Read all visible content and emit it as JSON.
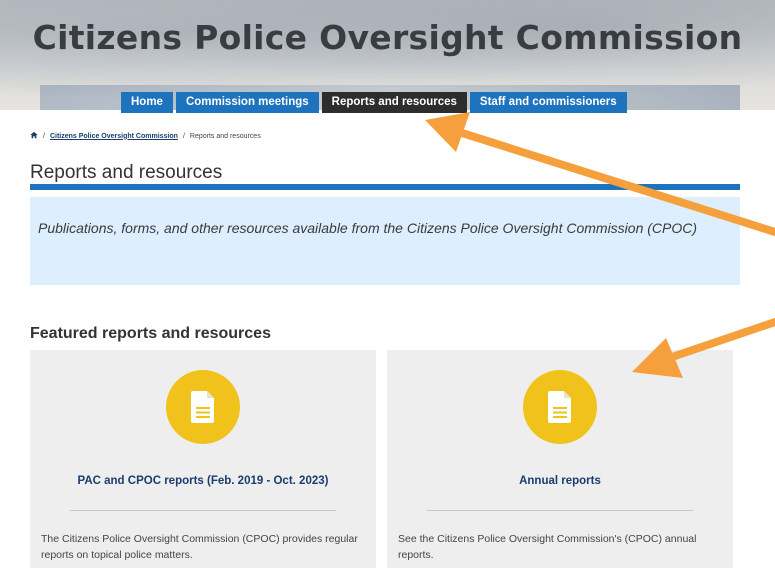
{
  "header": {
    "site_title": "Citizens Police Oversight Commission",
    "nav": [
      {
        "label": "Home"
      },
      {
        "label": "Commission meetings"
      },
      {
        "label": "Reports and resources",
        "active": true
      },
      {
        "label": "Staff and commissioners"
      }
    ]
  },
  "breadcrumb": {
    "home_icon": "home-icon",
    "separator": "/",
    "items": [
      "Citizens Police Oversight Commission",
      "Reports and resources"
    ]
  },
  "page": {
    "title": "Reports and resources",
    "lead": "Publications, forms, and other resources available from the Citizens Police Oversight Commission (CPOC)"
  },
  "featured": {
    "heading": "Featured reports and resources",
    "cards": [
      {
        "icon": "document-icon",
        "title": "PAC and CPOC reports (Feb. 2019 - Oct. 2023)",
        "description": "The Citizens Police Oversight Commission (CPOC) provides regular reports on topical police matters."
      },
      {
        "icon": "document-icon",
        "title": "Annual reports",
        "description": "See the Citizens Police Oversight Commission's (CPOC) annual reports."
      }
    ]
  },
  "annotations": {
    "arrow_color": "#f5a03c"
  },
  "colors": {
    "nav_blue": "#1e73be",
    "nav_active": "#2d2d2d",
    "lead_bg": "#ddeeff",
    "icon_yellow": "#f1c21b",
    "card_bg": "#eeeeee",
    "link_color": "#1a3c6e"
  }
}
